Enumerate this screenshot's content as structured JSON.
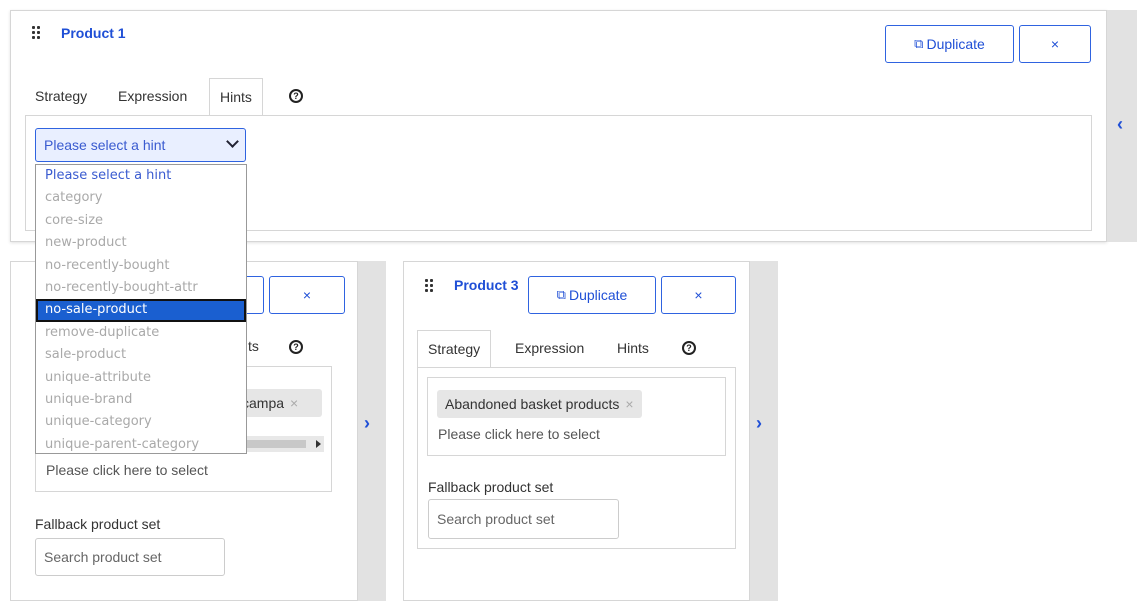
{
  "product1": {
    "title": "Product 1",
    "duplicate_label": "Duplicate",
    "close_label": "×",
    "tabs": [
      "Strategy",
      "Expression",
      "Hints"
    ],
    "hint_select": {
      "value": "Please select a hint",
      "options": [
        "Please select a hint",
        "category",
        "core-size",
        "new-product",
        "no-recently-bought",
        "no-recently-bought-attr",
        "no-sale-product",
        "remove-duplicate",
        "sale-product",
        "unique-attribute",
        "unique-brand",
        "unique-category",
        "unique-parent-category"
      ],
      "highlighted": "no-sale-product"
    },
    "expand_icon": "chevron-left-icon"
  },
  "product2": {
    "close_label": "×",
    "tab_partial": "ts",
    "tag_partial": "campa",
    "tag_remove": "×",
    "select_placeholder": "Please click here to select",
    "fallback_label": "Fallback product set",
    "fallback_placeholder": "Search product set",
    "expand_icon": "chevron-right-icon"
  },
  "product3": {
    "title": "Product 3",
    "duplicate_label": "Duplicate",
    "close_label": "×",
    "tabs": [
      "Strategy",
      "Expression",
      "Hints"
    ],
    "tag": "Abandoned basket products",
    "tag_remove": "×",
    "select_placeholder": "Please click here to select",
    "fallback_label": "Fallback product set",
    "fallback_placeholder": "Search product set",
    "expand_icon": "chevron-right-icon"
  },
  "help_glyph": "?"
}
